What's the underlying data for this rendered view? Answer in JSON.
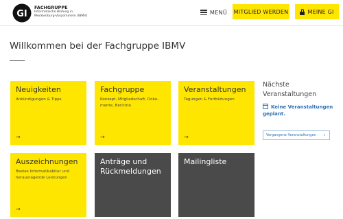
{
  "header": {
    "brand_title": "FACHGRUPPE",
    "brand_sub_line1": "Informatische Bildung in",
    "brand_sub_line2": "Mecklenburg-Vorpommern (IBMV)",
    "logo_text": "GI",
    "menu_label": "MENÜ",
    "member_label": "MITGLIED WERDEN",
    "mygi_label": "MEINE GI",
    "accent_color": "#ffe600"
  },
  "main": {
    "title": "Willkommen bei der Fachgruppe IBMV",
    "tiles": [
      {
        "title": "Neuigkeiten",
        "desc": "Ankündigungen & Tipps",
        "arrow": "→"
      },
      {
        "title": "Fachgruppe",
        "desc": "Konzept, Mitgliedschaft, Doku-mente, Berichte",
        "arrow": "→"
      },
      {
        "title": "Veranstaltungen",
        "desc": "Tagungen & Fortbildungen",
        "arrow": "→"
      },
      {
        "title": "Auszeichnungen",
        "desc": "Bestes Informatikabitur und herausragende Leistungen",
        "arrow": "→"
      },
      {
        "title": "Anträge und Rückmeldungen",
        "desc": "",
        "arrow": ""
      },
      {
        "title": "Mailingliste",
        "desc": "",
        "arrow": ""
      }
    ]
  },
  "sidebar": {
    "title": "Nächste Veranstaltungen",
    "empty_text": "Keine Veranstaltungen geplant.",
    "past_button": "Vergangene Veranstaltungen",
    "link_color": "#2f6fb4"
  }
}
